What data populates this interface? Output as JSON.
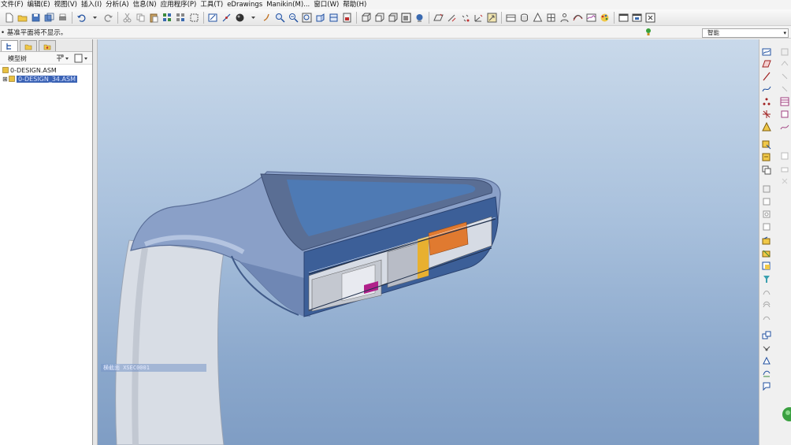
{
  "menu": {
    "items": [
      "文件(F)",
      "编辑(E)",
      "视图(V)",
      "插入(I)",
      "分析(A)",
      "信息(N)",
      "应用程序(P)",
      "工具(T)",
      "eDrawings",
      "Manikin(M)...",
      "窗口(W)",
      "帮助(H)"
    ]
  },
  "status": {
    "message": "• 基准平面将不显示。"
  },
  "filter": {
    "value": "智能"
  },
  "model_tree": {
    "header": "模型树",
    "root": "0-DESIGN.ASM",
    "child": "0-DESIGN_34.ASM"
  },
  "viewport": {
    "section_label": "横截面 XSEC0001"
  },
  "colors": {
    "accent": "#3a62b4",
    "viewport_top": "#c9d9ea",
    "viewport_bottom": "#7f9dc4",
    "part_blue": "#5f7fb0",
    "section_orange": "#e07a30",
    "section_magenta": "#b0208a"
  },
  "icons": {
    "toolbar": [
      "new-icon",
      "open-icon",
      "save-icon",
      "print-icon",
      "undo-icon",
      "redo-icon",
      "cut-icon",
      "copy-icon",
      "paste-icon",
      "regenerate-icon",
      "zoom-in-icon",
      "zoom-out-icon",
      "refit-icon",
      "shading-icon",
      "datum-icon",
      "window-icon"
    ]
  }
}
